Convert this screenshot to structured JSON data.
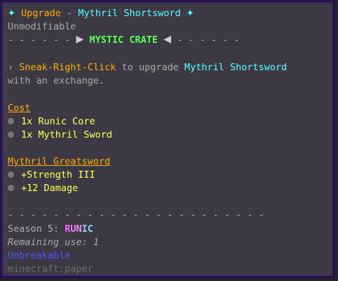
{
  "header": {
    "sparkle_left": "✦",
    "title_prefix": "Upgrade",
    "title_sep": "-",
    "item_name": "Mythril Shortsword",
    "sparkle_right": "✦"
  },
  "modifiable": "Unmodifiable",
  "crate": {
    "dashes_left": "- - - - - -",
    "arrow_left": "▶",
    "name": "MYSTIC CRATE",
    "arrow_right": "◀",
    "dashes_right": "- - - - - -"
  },
  "instruction": {
    "arrow": "›",
    "action": "Sneak-Right-Click",
    "middle": "to upgrade",
    "item": "Mythril Shortsword",
    "line2": "with an exchange."
  },
  "cost": {
    "heading": "Cost",
    "items": [
      "1x Runic Core",
      "1x Mythril Sword"
    ]
  },
  "result": {
    "heading": "Mythril Greatsword",
    "stats": [
      "+Strength III",
      "+12 Damage"
    ]
  },
  "divider": "- - - - - - - - - - - - - - - - - - - - - - -",
  "season": {
    "label": "Season 5:",
    "name": "RUNIC"
  },
  "remaining_use": "Remaining use: 1",
  "unbreakable": "Unbreakable",
  "item_id": "minecraft:paper",
  "colors": {
    "background": "#3d3a45",
    "border": "#240a52",
    "gold": "#ffaa00",
    "aqua": "#55ffff",
    "pink": "#ff77ff",
    "green": "#55ff55",
    "yellow": "#ffff55",
    "blue": "#5555ff"
  }
}
